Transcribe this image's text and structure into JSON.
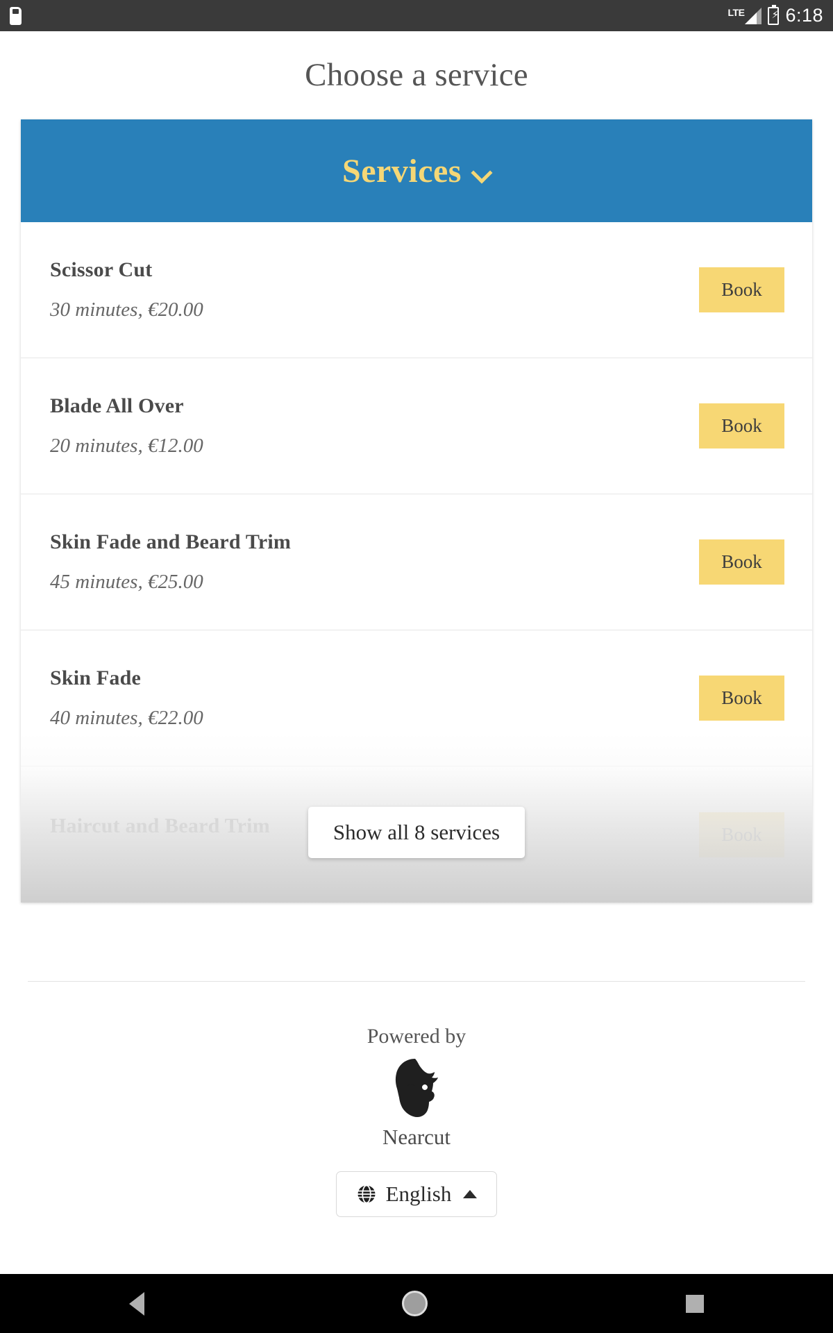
{
  "status_bar": {
    "sd_card_icon": "sd-card-icon",
    "network_label": "LTE",
    "signal_icon": "signal-bars-icon",
    "battery_icon": "battery-charging-icon",
    "battery_bolt": "⚡",
    "time": "6:18"
  },
  "page": {
    "title": "Choose a service"
  },
  "card": {
    "header_title": "Services",
    "header_chevron": "chevron-down-icon",
    "accent_blue": "#2980b9",
    "accent_yellow": "#f5d776",
    "book_button_color": "#f7d774",
    "services": [
      {
        "name": "Scissor Cut",
        "meta": "30 minutes, €20.00",
        "book_label": "Book"
      },
      {
        "name": "Blade All Over",
        "meta": "20 minutes, €12.00",
        "book_label": "Book"
      },
      {
        "name": "Skin Fade and Beard Trim",
        "meta": "45 minutes, €25.00",
        "book_label": "Book"
      },
      {
        "name": "Skin Fade",
        "meta": "40 minutes, €22.00",
        "book_label": "Book"
      },
      {
        "name": "Haircut and Beard Trim",
        "meta": "",
        "book_label": "Book"
      }
    ],
    "show_all_label": "Show all 8 services"
  },
  "footer": {
    "powered_by": "Powered by",
    "logo_icon": "bearded-man-logo-icon",
    "brand": "Nearcut",
    "language": {
      "globe_icon": "globe-icon",
      "label": "English",
      "caret_icon": "caret-up-icon"
    }
  },
  "nav_bar": {
    "back_icon": "back-triangle-icon",
    "home_icon": "home-circle-icon",
    "recents_icon": "recents-square-icon"
  }
}
